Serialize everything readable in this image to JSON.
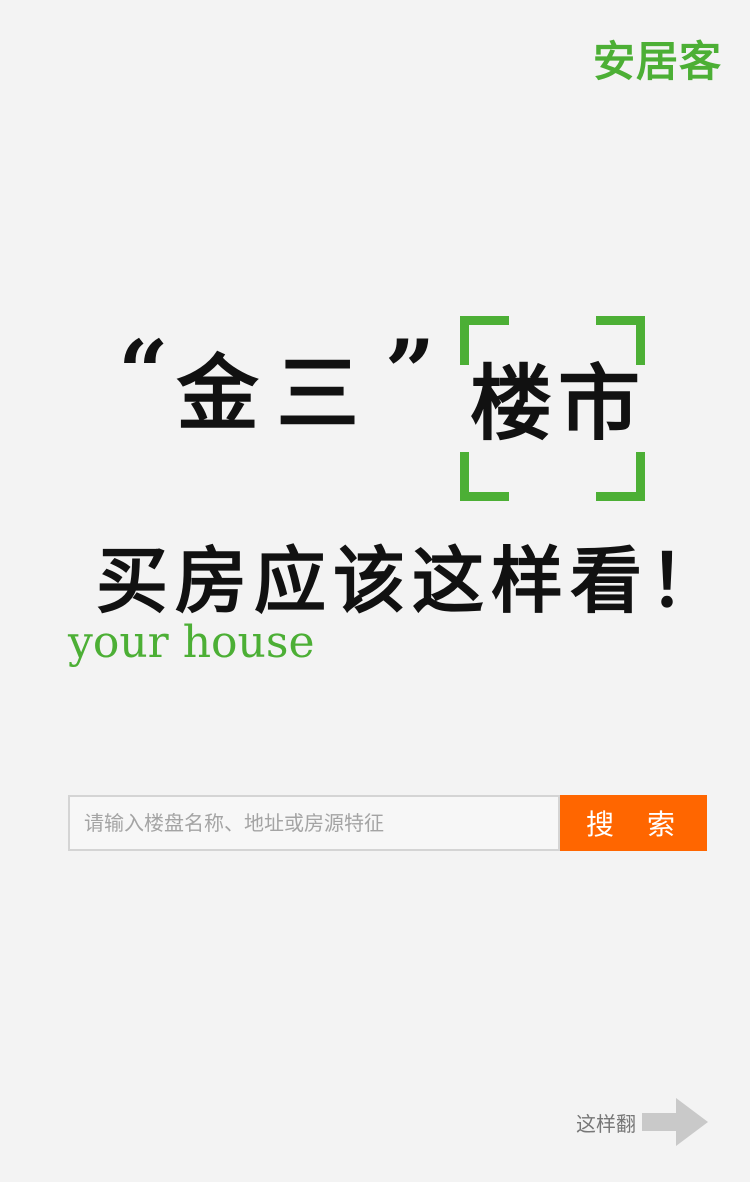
{
  "header": {
    "logo_text": "安居客"
  },
  "headline": {
    "quote_open": "“",
    "gold_three": "金三",
    "quote_close": "”",
    "market": "楼市",
    "subtitle": "买房应该这样看！",
    "accent_text": "your house"
  },
  "search": {
    "placeholder": "请输入楼盘名称、地址或房源特征",
    "button_label": "搜 索"
  },
  "footer": {
    "swipe_text": "这样翻"
  },
  "colors": {
    "brand_green": "#4caf35",
    "search_orange": "#ff6600",
    "background": "#f3f3f3"
  },
  "icons": {
    "swipe_arrow": "arrow-right-icon"
  }
}
